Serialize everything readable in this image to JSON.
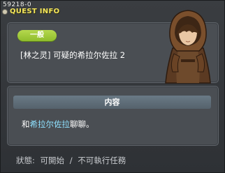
{
  "window": {
    "quest_id": "59218-0",
    "title": "QUEST INFO"
  },
  "quest": {
    "category_badge": "一般",
    "name": "[林之灵] 可疑的希拉尔佐拉 2"
  },
  "content": {
    "header": "内容",
    "text_prefix": "和",
    "text_highlight": "希拉尔佐拉",
    "text_suffix": "聊聊。"
  },
  "status": {
    "label": "狀態:",
    "start": "可開始",
    "separator": "/",
    "execute": "不可執行任務"
  },
  "colors": {
    "title": "#f5e65a",
    "badge": "#9ccb38",
    "highlight": "#8fe1ff",
    "panel": "#4a4e53"
  }
}
